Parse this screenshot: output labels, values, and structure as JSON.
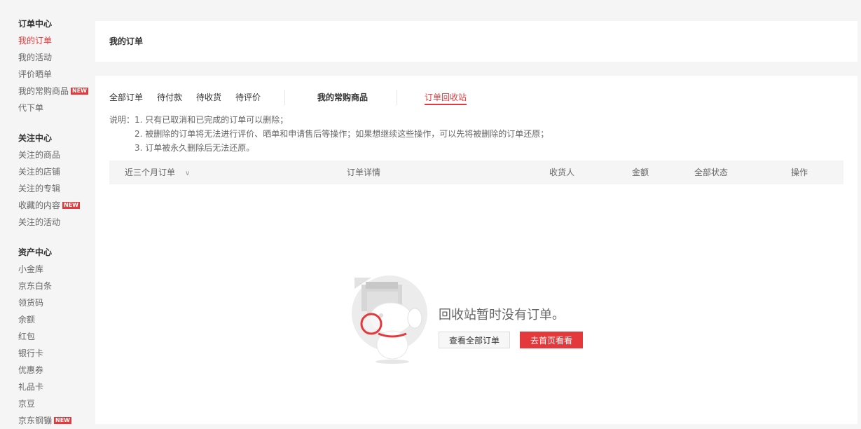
{
  "sidebar": {
    "groups": [
      {
        "title": "订单中心",
        "items": [
          {
            "label": "我的订单",
            "active": true
          },
          {
            "label": "我的活动"
          },
          {
            "label": "评价晒单"
          },
          {
            "label": "我的常购商品",
            "badge": "NEW"
          },
          {
            "label": "代下单"
          }
        ]
      },
      {
        "title": "关注中心",
        "items": [
          {
            "label": "关注的商品"
          },
          {
            "label": "关注的店铺"
          },
          {
            "label": "关注的专辑"
          },
          {
            "label": "收藏的内容",
            "badge": "NEW"
          },
          {
            "label": "关注的活动"
          }
        ]
      },
      {
        "title": "资产中心",
        "items": [
          {
            "label": "小金库"
          },
          {
            "label": "京东白条"
          },
          {
            "label": "领货码"
          },
          {
            "label": "余额"
          },
          {
            "label": "红包"
          },
          {
            "label": "银行卡"
          },
          {
            "label": "优惠券"
          },
          {
            "label": "礼品卡"
          },
          {
            "label": "京豆"
          },
          {
            "label": "京东钢镚",
            "badge": "NEW"
          }
        ]
      }
    ]
  },
  "header": {
    "title": "我的订单"
  },
  "tabs": {
    "all": "全部订单",
    "to_pay": "待付款",
    "to_receive": "待收货",
    "to_review": "待评价",
    "frequent": "我的常购商品",
    "recycle": "订单回收站"
  },
  "notes": {
    "prefix": "说明：",
    "line1": "1. 只有已取消和已完成的订单可以删除；",
    "line2": "2. 被删除的订单将无法进行评价、晒单和申请售后等操作；如果想继续这些操作，可以先将被删除的订单还原；",
    "line3": "3. 订单被永久删除后无法还原。"
  },
  "table": {
    "period": "近三个月订单",
    "detail": "订单详情",
    "receiver": "收货人",
    "amount": "金额",
    "status": "全部状态",
    "action": "操作"
  },
  "empty": {
    "message": "回收站暂时没有订单。",
    "view_all": "查看全部订单",
    "go_home": "去首页看看"
  },
  "colors": {
    "accent": "#e4393c",
    "panel_bg": "#ffffff",
    "page_bg": "#f5f5f5"
  },
  "icons": {
    "period_dropdown": "chevron-down-icon",
    "illustration": "empty-recycle-illustration"
  }
}
